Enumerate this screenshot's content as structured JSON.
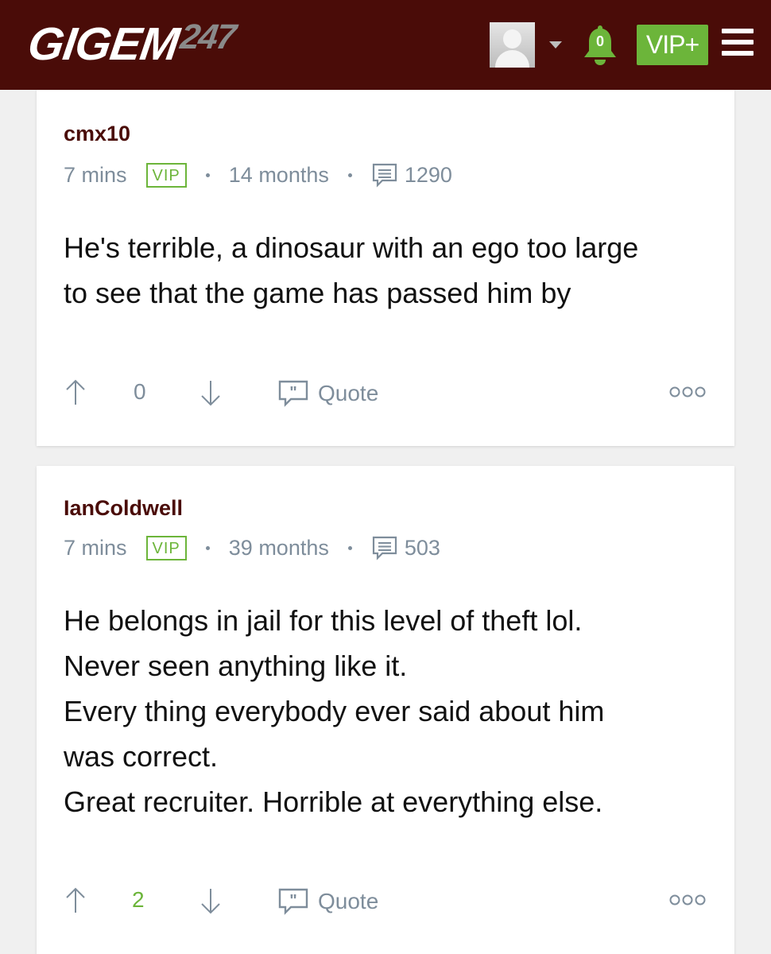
{
  "header": {
    "logo_brand": "GIGEM",
    "logo_number": "247",
    "notification_count": "0",
    "vip_plus_label": "VIP+"
  },
  "posts": [
    {
      "username": "cmx10",
      "time": "7 mins",
      "badge": "VIP",
      "tenure": "14 months",
      "post_count": "1290",
      "lines": [
        "He's terrible, a dinosaur with an ego too large",
        "to see that the game has passed him by"
      ],
      "votes": "0",
      "quote_label": "Quote"
    },
    {
      "username": "IanColdwell",
      "time": "7 mins",
      "badge": "VIP",
      "tenure": "39 months",
      "post_count": "503",
      "lines": [
        "He belongs in jail for this level of theft lol.",
        "Never seen anything like it.",
        "Every thing everybody ever said about him",
        "was correct.",
        "Great recruiter. Horrible at everything else."
      ],
      "votes": "2",
      "quote_label": "Quote"
    }
  ],
  "colors": {
    "header_bg": "#4a0c08",
    "accent_green": "#6cb53a",
    "username": "#4a0c08",
    "meta_gray": "#7e8d9b"
  },
  "icons": [
    "avatar",
    "chevron-down-icon",
    "bell-icon",
    "menu-icon",
    "message-icon",
    "arrow-up-icon",
    "arrow-down-icon",
    "quote-icon",
    "more-icon"
  ]
}
